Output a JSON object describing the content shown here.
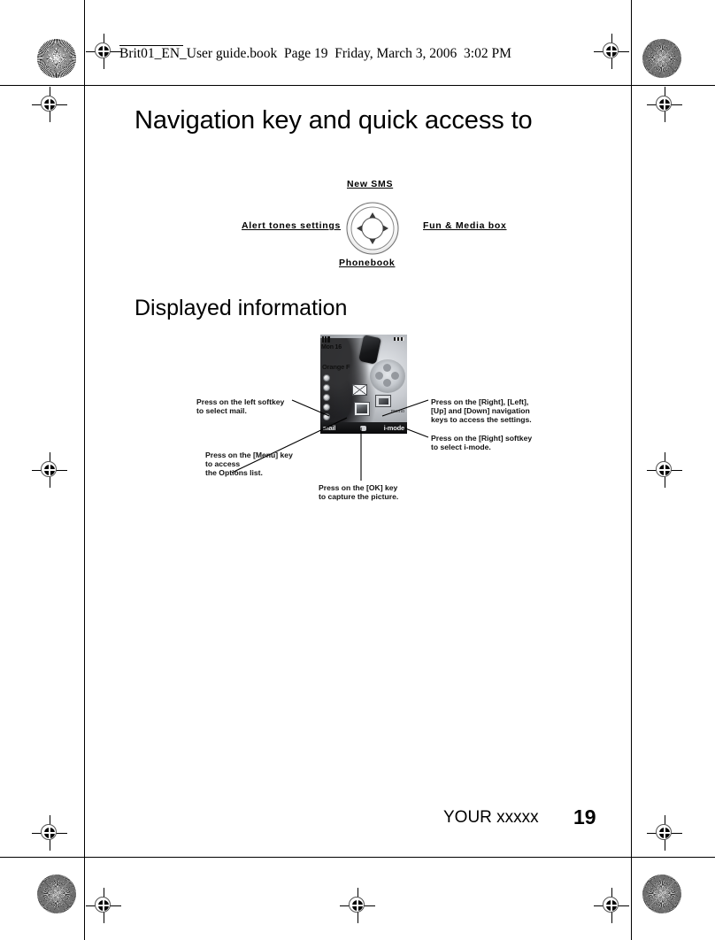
{
  "running_header": {
    "text": "Brit01_EN_User guide.book  Page 19  Friday, March 3, 2006  3:02 PM"
  },
  "headings": {
    "section_title": "Navigation key and quick access to",
    "sub_title": "Displayed information"
  },
  "nav_diagram": {
    "top_label": "New SMS",
    "left_label": "Alert tones settings",
    "right_label": "Fun & Media box",
    "bottom_label": "Phonebook",
    "key_name": "navigation-key",
    "arrows": [
      "up",
      "right",
      "down",
      "left"
    ]
  },
  "phone_screen": {
    "status_date": "Mon 16",
    "operator": "Orange F",
    "softkey_left": "mail",
    "softkey_right": "i-mode",
    "memo_label": "memo",
    "icons": [
      "envelope-icon",
      "camera-icon",
      "picture-icon"
    ]
  },
  "callouts": {
    "left_softkey": "Press on the left softkey\nto select mail.",
    "menu_key": "Press on the [Menu] key\nto access\nthe Options list.",
    "ok_key": "Press on the [OK] key\nto capture the picture.",
    "navigation_keys": "Press on the [Right], [Left],\n[Up] and [Down] navigation\nkeys to access the settings.",
    "right_softkey": "Press on the [Right] softkey\nto select i-mode."
  },
  "footer": {
    "title": "YOUR xxxxx",
    "page_number": "19"
  },
  "colors": {
    "text": "#000000",
    "page_background": "#ffffff",
    "mark": "#000000"
  }
}
